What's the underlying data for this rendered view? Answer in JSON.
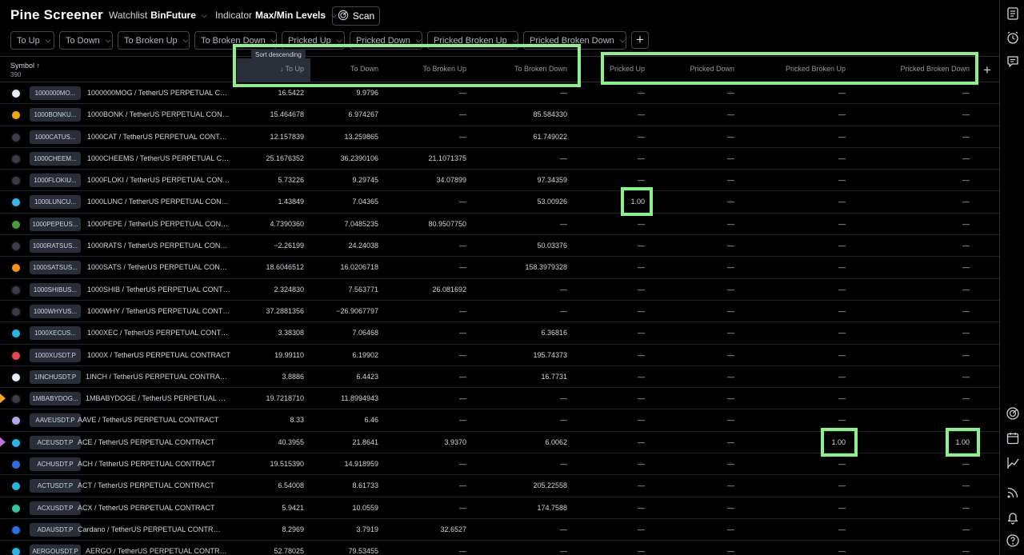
{
  "app": {
    "title": "Pine Screener",
    "watchlist_label": "Watchlist",
    "watchlist_value": "BinFuture",
    "indicator_label": "Indicator",
    "indicator_value": "Max/Min Levels",
    "scan_label": "Scan"
  },
  "filters": [
    "To Up",
    "To Down",
    "To Broken Up",
    "To Broken Down",
    "Pricked Up",
    "Pricked Down",
    "Pricked Broken Up",
    "Pricked Broken Down"
  ],
  "table": {
    "symbol_header": "Symbol",
    "sort_arrow": "↑",
    "count": "390",
    "columns": [
      "To Up",
      "To Down",
      "To Broken Up",
      "To Broken Down",
      "Pricked Up",
      "Pricked Down",
      "Pricked Broken Up",
      "Pricked Broken Down"
    ],
    "active_sort_glyph": "↓",
    "tooltip": "Sort descending",
    "rows": [
      {
        "ticker": "1000000MO...",
        "desc": "1000000MOG / TetherUS PERPETUAL CO...",
        "coin": "#e9eef5",
        "flag": "",
        "vals": [
          "16.5422",
          "9.9796",
          "—",
          "—",
          "—",
          "—",
          "—",
          "—"
        ]
      },
      {
        "ticker": "1000BONKU...",
        "desc": "1000BONK / TetherUS PERPETUAL CONT...",
        "coin": "#f7a21b",
        "flag": "",
        "vals": [
          "15.464678",
          "6.974267",
          "—",
          "85.584330",
          "—",
          "—",
          "—",
          "—"
        ]
      },
      {
        "ticker": "1000CATUS...",
        "desc": "1000CAT / TetherUS PERPETUAL CONTRA...",
        "coin": "#3a3d45",
        "flag": "",
        "vals": [
          "12.157839",
          "13.259865",
          "—",
          "61.749022",
          "—",
          "—",
          "—",
          "—"
        ]
      },
      {
        "ticker": "1000CHEEM...",
        "desc": "1000CHEEMS / TetherUS PERPETUAL CON...",
        "coin": "#3a3d45",
        "flag": "",
        "vals": [
          "25.1676352",
          "36.2390106",
          "21.1071375",
          "—",
          "—",
          "—",
          "—",
          "—"
        ]
      },
      {
        "ticker": "1000FLOKIU...",
        "desc": "1000FLOKI / TetherUS PERPETUAL CONT...",
        "coin": "#3a3d45",
        "flag": "",
        "vals": [
          "5.73226",
          "9.29745",
          "34.07899",
          "97.34359",
          "—",
          "—",
          "—",
          "—"
        ]
      },
      {
        "ticker": "1000LUNCU...",
        "desc": "1000LUNC / TetherUS PERPETUAL CONTR...",
        "coin": "#3fb6e8",
        "flag": "",
        "vals": [
          "1.43849",
          "7.04365",
          "—",
          "53.00926",
          "1.00",
          "—",
          "—",
          "—"
        ]
      },
      {
        "ticker": "1000PEPEUS...",
        "desc": "1000PEPE / TetherUS PERPETUAL CONTR...",
        "coin": "#4a9a3c",
        "flag": "",
        "vals": [
          "4.7390360",
          "7.0485235",
          "80.9507750",
          "—",
          "—",
          "—",
          "—",
          "—"
        ]
      },
      {
        "ticker": "1000RATSUS...",
        "desc": "1000RATS / TetherUS PERPETUAL CONTR...",
        "coin": "#3a3d45",
        "flag": "",
        "vals": [
          "−2.26199",
          "24.24038",
          "—",
          "50.03376",
          "—",
          "—",
          "—",
          "—"
        ]
      },
      {
        "ticker": "1000SATSUS...",
        "desc": "1000SATS / TetherUS PERPETUAL CONTR...",
        "coin": "#f7931a",
        "flag": "",
        "vals": [
          "18.6046512",
          "16.0206718",
          "—",
          "158.3979328",
          "—",
          "—",
          "—",
          "—"
        ]
      },
      {
        "ticker": "1000SHIBUS...",
        "desc": "1000SHIB / TetherUS PERPETUAL CONTR...",
        "coin": "#3a3d45",
        "flag": "",
        "vals": [
          "2.324830",
          "7.563771",
          "26.081692",
          "—",
          "—",
          "—",
          "—",
          "—"
        ]
      },
      {
        "ticker": "1000WHYUS...",
        "desc": "1000WHY / TetherUS PERPETUAL CONTR...",
        "coin": "#3a3d45",
        "flag": "",
        "vals": [
          "37.2881356",
          "−26.9067797",
          "—",
          "—",
          "—",
          "—",
          "—",
          "—"
        ]
      },
      {
        "ticker": "1000XECUS...",
        "desc": "1000XEC / TetherUS PERPETUAL CONTRA...",
        "coin": "#2bb3e6",
        "flag": "",
        "vals": [
          "3.38308",
          "7.06468",
          "—",
          "6.36816",
          "—",
          "—",
          "—",
          "—"
        ]
      },
      {
        "ticker": "1000XUSDT.P",
        "desc": "1000X / TetherUS PERPETUAL CONTRACT",
        "coin": "#e5484d",
        "flag": "",
        "vals": [
          "19.99110",
          "6.19902",
          "—",
          "195.74373",
          "—",
          "—",
          "—",
          "—"
        ]
      },
      {
        "ticker": "1INCHUSDT.P",
        "desc": "1INCH / TetherUS PERPETUAL CONTRACT",
        "coin": "#e9eef5",
        "flag": "",
        "vals": [
          "3.8886",
          "6.4423",
          "—",
          "16.7731",
          "—",
          "—",
          "—",
          "—"
        ]
      },
      {
        "ticker": "1MBABYDOG...",
        "desc": "1MBABYDOGE / TetherUS PERPETUAL CO...",
        "coin": "#3a3d45",
        "flag": "#f5a623",
        "vals": [
          "19.7218710",
          "11.8994943",
          "—",
          "—",
          "—",
          "—",
          "—",
          "—"
        ]
      },
      {
        "ticker": "AAVEUSDT.P",
        "desc": "AAVE / TetherUS PERPETUAL CONTRACT",
        "coin": "#b6a8f0",
        "flag": "",
        "vals": [
          "8.33",
          "6.46",
          "—",
          "—",
          "—",
          "—",
          "—",
          "—"
        ]
      },
      {
        "ticker": "ACEUSDT.P",
        "desc": "ACE / TetherUS PERPETUAL CONTRACT",
        "coin": "#2bb3e6",
        "flag": "#c36be0",
        "vals": [
          "40.3955",
          "21.8641",
          "3.9370",
          "6.0062",
          "—",
          "—",
          "1.00",
          "1.00"
        ]
      },
      {
        "ticker": "ACHUSDT.P",
        "desc": "ACH / TetherUS PERPETUAL CONTRACT",
        "coin": "#2e6fe0",
        "flag": "",
        "vals": [
          "19.515390",
          "14.918959",
          "—",
          "—",
          "—",
          "—",
          "—",
          "—"
        ]
      },
      {
        "ticker": "ACTUSDT.P",
        "desc": "ACT / TetherUS PERPETUAL CONTRACT",
        "coin": "#2bb3e6",
        "flag": "",
        "vals": [
          "6.54008",
          "8.61733",
          "—",
          "205.22558",
          "—",
          "—",
          "—",
          "—"
        ]
      },
      {
        "ticker": "ACXUSDT.P",
        "desc": "ACX / TetherUS PERPETUAL CONTRACT",
        "coin": "#37c3a0",
        "flag": "",
        "vals": [
          "5.9421",
          "10.0559",
          "—",
          "174.7588",
          "—",
          "—",
          "—",
          "—"
        ]
      },
      {
        "ticker": "ADAUSDT.P",
        "desc": "Cardano / TetherUS PERPETUAL CONTRACT",
        "coin": "#2e6fe0",
        "flag": "",
        "vals": [
          "8.2969",
          "3.7919",
          "32.6527",
          "—",
          "—",
          "—",
          "—",
          "—"
        ]
      },
      {
        "ticker": "AERGOUSDT.P",
        "desc": "AERGO / TetherUS PERPETUAL CONTRACT",
        "coin": "#2bb3e6",
        "flag": "",
        "vals": [
          "52.78025",
          "79.53455",
          "—",
          "—",
          "—",
          "—",
          "—",
          "—"
        ]
      }
    ]
  }
}
